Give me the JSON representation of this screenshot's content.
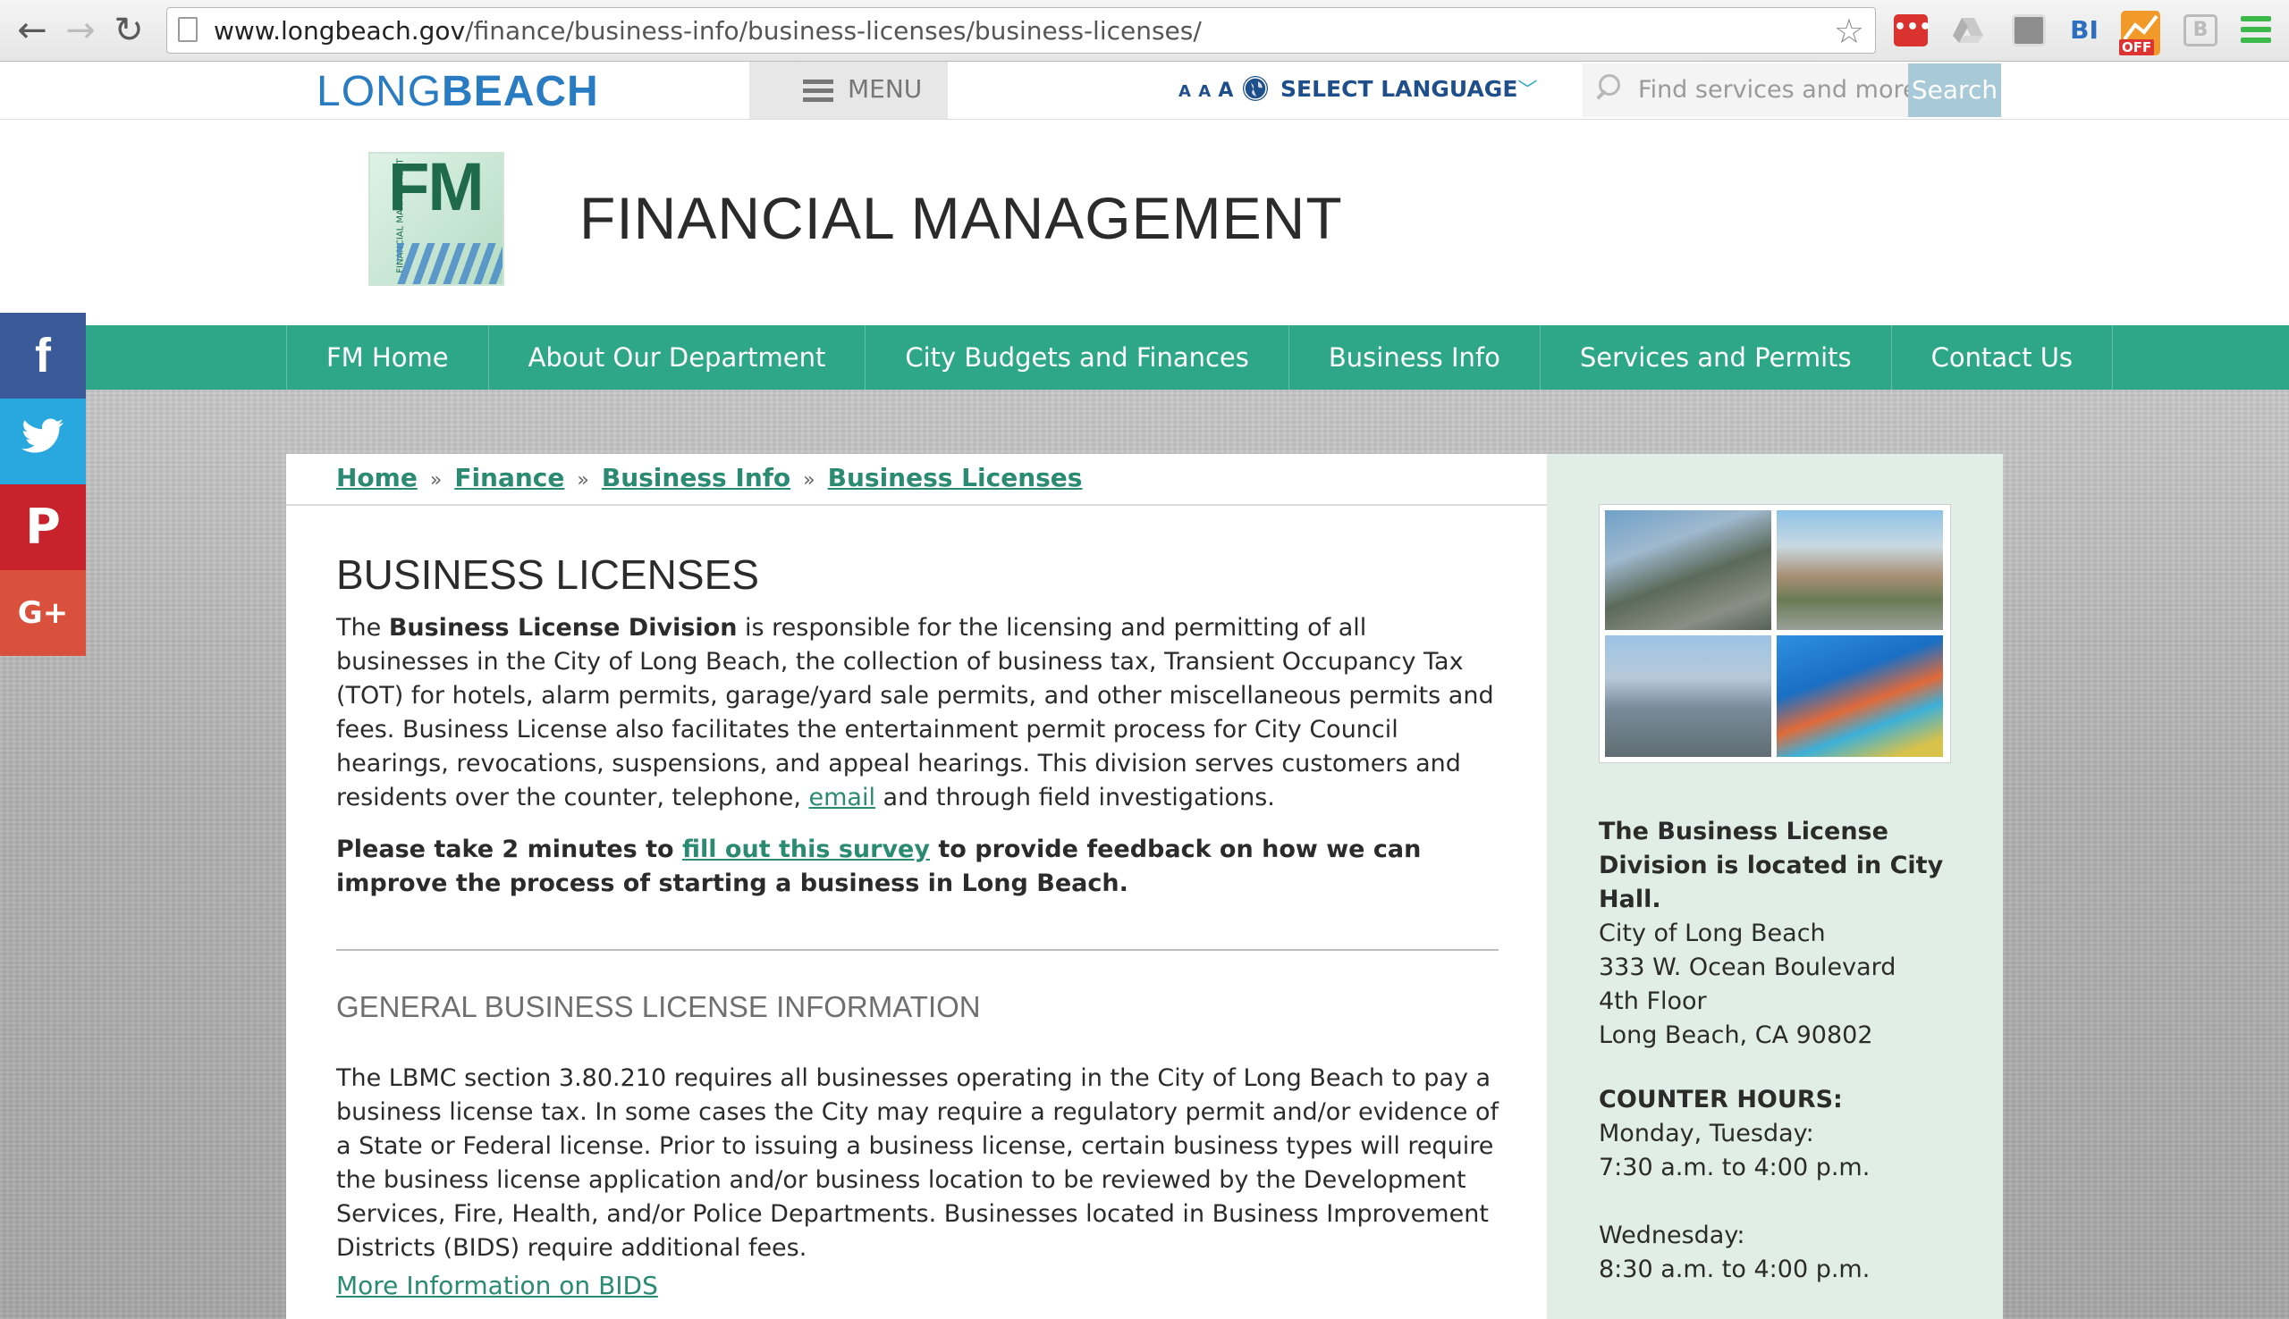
{
  "browser": {
    "url_domain": "www.longbeach.gov",
    "url_path": "/finance/business-info/business-licenses/business-licenses/",
    "ext_badge_1": "•••",
    "ext_badge_4": "BI",
    "ext_badge_5_off": "OFF",
    "ext_badge_6": "B"
  },
  "site": {
    "logo_part1": "LONG",
    "logo_part2": "BEACH",
    "menu_label": "MENU",
    "text_size_small": "A A",
    "text_size_large": "A",
    "language_label": "SELECT LANGUAGE",
    "search_placeholder": "Find services and more",
    "search_button": "Search"
  },
  "department": {
    "logo_text": "FM",
    "logo_vertical_text": "FINANCIAL MANAGEMENT",
    "title": "FINANCIAL MANAGEMENT"
  },
  "nav": {
    "items": [
      {
        "label": "FM Home"
      },
      {
        "label": "About Our Department"
      },
      {
        "label": "City Budgets and Finances"
      },
      {
        "label": "Business Info"
      },
      {
        "label": "Services and Permits"
      },
      {
        "label": "Contact Us"
      }
    ]
  },
  "social": {
    "facebook": "f",
    "pinterest": "P",
    "googleplus": "G+"
  },
  "breadcrumb": {
    "items": [
      "Home",
      "Finance",
      "Business Info",
      "Business Licenses"
    ],
    "separator": "»"
  },
  "main": {
    "title": "BUSINESS LICENSES",
    "p1_intro": "The ",
    "p1_bold": "Business License Division",
    "p1_body": " is responsible for the licensing and permitting of all businesses in the City of Long Beach, the collection of business tax, Transient Occupancy Tax (TOT) for hotels, alarm permits, garage/yard sale permits, and other miscellaneous permits and fees. Business License also facilitates the entertainment permit process for City Council hearings, revocations, suspensions, and appeal hearings. This division serves customers and residents over the counter, telephone, ",
    "p1_link": "email",
    "p1_end": " and through field investigations.",
    "p2_start": "Please take 2 minutes to ",
    "p2_link": "fill out this survey",
    "p2_end": " to provide feedback on how we can improve the process of starting a business in Long Beach.",
    "subheading": "GENERAL BUSINESS LICENSE INFORMATION",
    "p3": "The LBMC section 3.80.210 requires all businesses operating in the City of Long Beach to pay a business license tax. In some cases the City may require a regulatory permit and/or evidence of a State or Federal license. Prior to issuing a business license, certain business types will require the business license application and/or business location to be reviewed by the Development Services, Fire, Health, and/or Police Departments. Businesses located in Business Improvement Districts (BIDS) require additional fees.",
    "bids_link": "More Information on BIDS"
  },
  "sidebar": {
    "location_head": "The Business License Division is located in City Hall.",
    "address_lines": [
      "City of Long Beach",
      "333 W. Ocean Boulevard",
      "4th Floor",
      "Long Beach, CA 90802"
    ],
    "hours_head": "COUNTER HOURS:",
    "hours_1_days": "Monday, Tuesday:",
    "hours_1_time": "7:30 a.m. to 4:00 p.m.",
    "hours_2_days": "Wednesday:",
    "hours_2_time": "8:30 a.m. to 4:00 p.m."
  }
}
